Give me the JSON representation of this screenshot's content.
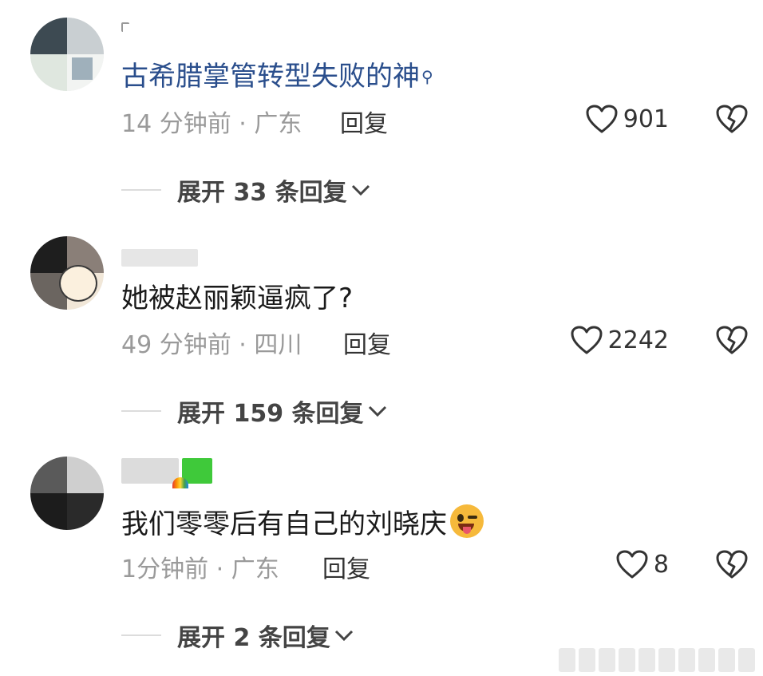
{
  "comments": [
    {
      "text": "古希腊掌管转型失败的神",
      "time": "14 分钟前",
      "location": "广东",
      "reply_label": "回复",
      "likes": "901",
      "expand_label": "展开 33 条回复"
    },
    {
      "text": "她被赵丽颖逼疯了?",
      "time": "49 分钟前",
      "location": "四川",
      "reply_label": "回复",
      "likes": "2242",
      "expand_label": "展开 159 条回复"
    },
    {
      "text": "我们零零后有自己的刘晓庆",
      "time": "1分钟前",
      "location": "广东",
      "reply_label": "回复",
      "likes": "8",
      "expand_label": "展开 2 条回复"
    }
  ],
  "icons": {
    "heart": "heart-outline-icon",
    "broken_heart": "broken-heart-icon",
    "chevron": "chevron-down-icon",
    "search": "search-icon",
    "emoji": "winking-tongue-emoji"
  },
  "colors": {
    "link_text": "#2a4e8c",
    "meta_text": "#9a9a9a",
    "body_text": "#1a1a1a"
  }
}
